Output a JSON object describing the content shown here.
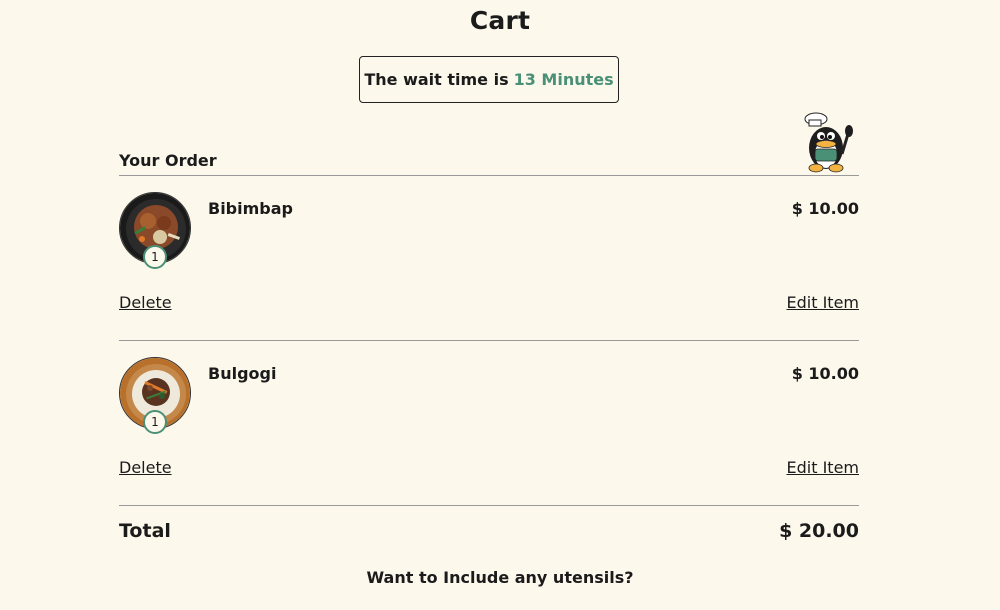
{
  "page": {
    "title": "Cart"
  },
  "wait": {
    "prefix": "The wait time is",
    "value": "13 Minutes"
  },
  "order": {
    "heading": "Your Order",
    "items": [
      {
        "name": "Bibimbap",
        "price": "$ 10.00",
        "quantity": "1",
        "delete_label": "Delete",
        "edit_label": "Edit Item"
      },
      {
        "name": "Bulgogi",
        "price": "$ 10.00",
        "quantity": "1",
        "delete_label": "Delete",
        "edit_label": "Edit Item"
      }
    ]
  },
  "total": {
    "label": "Total",
    "value": "$ 20.00"
  },
  "utensils": {
    "prompt": "Want to Include any utensils?"
  },
  "colors": {
    "background": "#fdf8ec",
    "accent": "#4a9077",
    "text": "#1b1b1b"
  },
  "icons": {
    "mascot": "penguin-chef-icon"
  }
}
